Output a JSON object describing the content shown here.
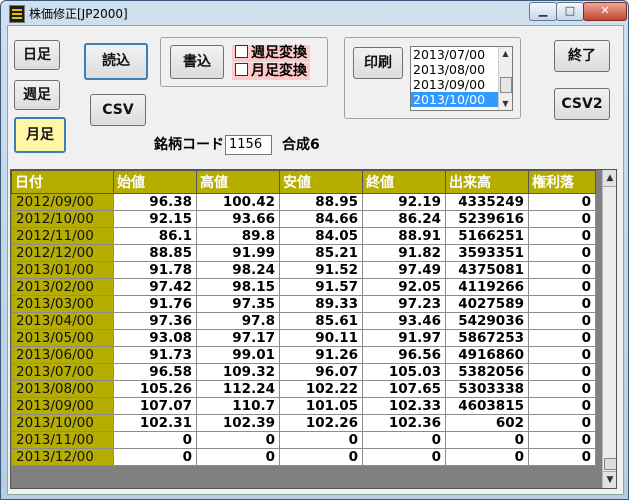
{
  "window": {
    "title": "株価修正[JP2000]",
    "min": "▁",
    "max": "□",
    "close": "✕"
  },
  "buttons": {
    "daily": "日足",
    "weekly": "週足",
    "monthly": "月足",
    "load": "読込",
    "csv": "CSV",
    "write": "書込",
    "print": "印刷",
    "exit": "終了",
    "csv2": "CSV2"
  },
  "checks": {
    "weekly_convert": "週足変換",
    "monthly_convert": "月足変換"
  },
  "print_list": {
    "items": [
      "2013/07/00",
      "2013/08/00",
      "2013/09/00",
      "2013/10/00"
    ],
    "selected_index": 3
  },
  "code": {
    "label": "銘柄コード",
    "value": "1156",
    "name": "合成6"
  },
  "grid": {
    "headers": [
      "日付",
      "始値",
      "高値",
      "安値",
      "終値",
      "出来高",
      "権利落"
    ],
    "rows": [
      [
        "2012/09/00",
        "96.38",
        "100.42",
        "88.95",
        "92.19",
        "4335249",
        "0"
      ],
      [
        "2012/10/00",
        "92.15",
        "93.66",
        "84.66",
        "86.24",
        "5239616",
        "0"
      ],
      [
        "2012/11/00",
        "86.1",
        "89.8",
        "84.05",
        "88.91",
        "5166251",
        "0"
      ],
      [
        "2012/12/00",
        "88.85",
        "91.99",
        "85.21",
        "91.82",
        "3593351",
        "0"
      ],
      [
        "2013/01/00",
        "91.78",
        "98.24",
        "91.52",
        "97.49",
        "4375081",
        "0"
      ],
      [
        "2013/02/00",
        "97.42",
        "98.15",
        "91.57",
        "92.05",
        "4119266",
        "0"
      ],
      [
        "2013/03/00",
        "91.76",
        "97.35",
        "89.33",
        "97.23",
        "4027589",
        "0"
      ],
      [
        "2013/04/00",
        "97.36",
        "97.8",
        "85.61",
        "93.46",
        "5429036",
        "0"
      ],
      [
        "2013/05/00",
        "93.08",
        "97.17",
        "90.11",
        "91.97",
        "5867253",
        "0"
      ],
      [
        "2013/06/00",
        "91.73",
        "99.01",
        "91.26",
        "96.56",
        "4916860",
        "0"
      ],
      [
        "2013/07/00",
        "96.58",
        "109.32",
        "96.07",
        "105.03",
        "5382056",
        "0"
      ],
      [
        "2013/08/00",
        "105.26",
        "112.24",
        "102.22",
        "107.65",
        "5303338",
        "0"
      ],
      [
        "2013/09/00",
        "107.07",
        "110.7",
        "101.05",
        "102.33",
        "4603815",
        "0"
      ],
      [
        "2013/10/00",
        "102.31",
        "102.39",
        "102.26",
        "102.36",
        "602",
        "0"
      ],
      [
        "2013/11/00",
        "0",
        "0",
        "0",
        "0",
        "0",
        "0"
      ],
      [
        "2013/12/00",
        "0",
        "0",
        "0",
        "0",
        "0",
        "0"
      ]
    ]
  }
}
